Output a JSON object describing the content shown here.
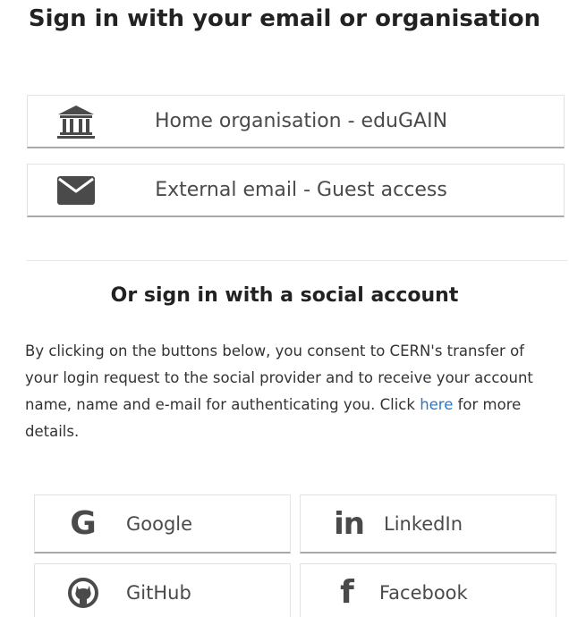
{
  "title": "Sign in with your email or organisation",
  "providers": {
    "home": {
      "label": "Home organisation - eduGAIN",
      "icon": "institution-icon"
    },
    "guest": {
      "label": "External email - Guest access",
      "icon": "envelope-icon"
    }
  },
  "social": {
    "heading": "Or sign in with a social account",
    "consent_before": "By clicking on the buttons below, you consent to CERN's transfer of your login request to the social provider and to receive your account name, name and e-mail for authenticating you. Click ",
    "consent_link": "here",
    "consent_after": " for more details.",
    "buttons": {
      "google": {
        "label": "Google",
        "icon": "google-icon"
      },
      "linkedin": {
        "label": "LinkedIn",
        "icon": "linkedin-icon"
      },
      "github": {
        "label": "GitHub",
        "icon": "github-icon"
      },
      "facebook": {
        "label": "Facebook",
        "icon": "facebook-icon"
      }
    }
  },
  "colors": {
    "link": "#2a78c8",
    "button_text": "#4a4a4a",
    "button_border_bottom": "#a9a9a9"
  }
}
